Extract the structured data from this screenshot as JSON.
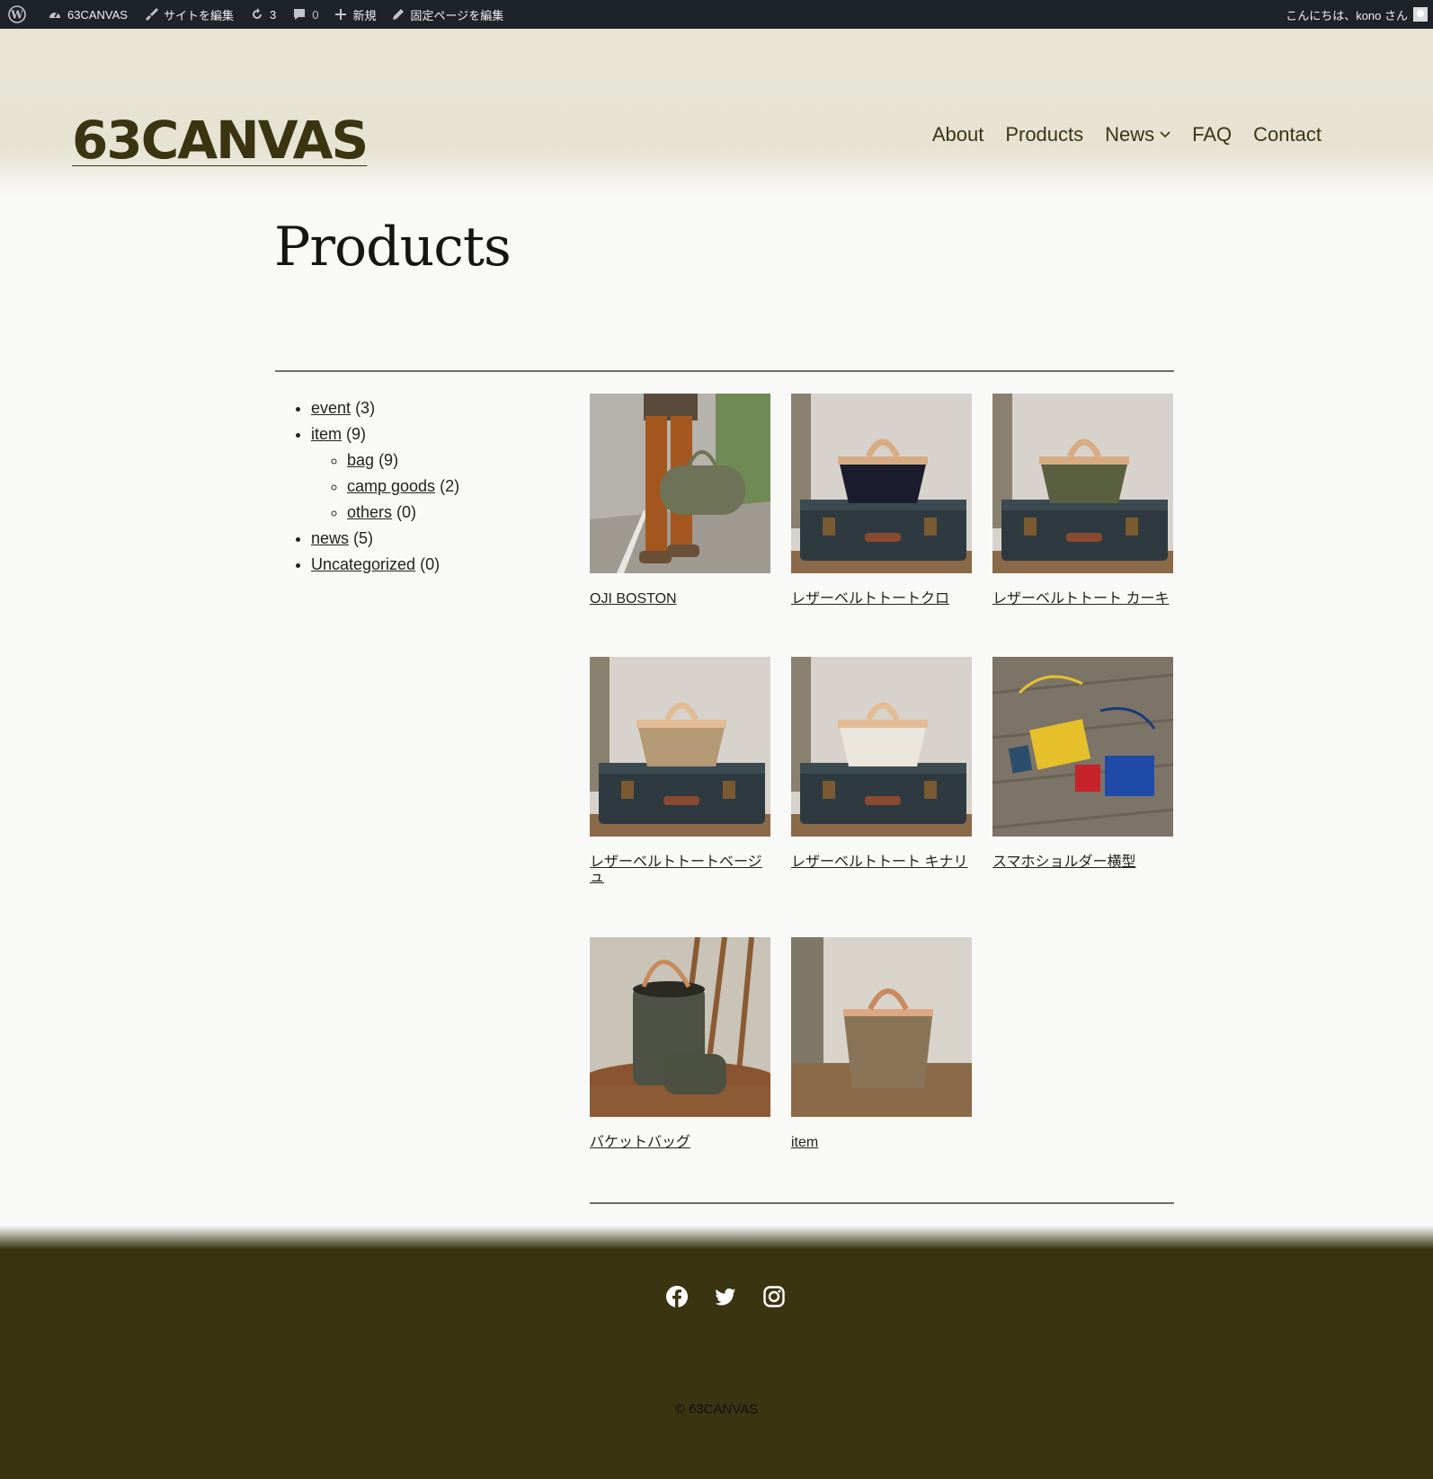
{
  "adminbar": {
    "site_name": "63CANVAS",
    "edit_site": "サイトを編集",
    "updates": "3",
    "comments": "0",
    "new": "新規",
    "edit_page": "固定ページを編集",
    "greeting": "こんにちは、kono さん"
  },
  "header": {
    "site_title": "63CANVAS",
    "nav": [
      "About",
      "Products",
      "News",
      "FAQ",
      "Contact"
    ]
  },
  "page": {
    "title": "Products"
  },
  "categories": [
    {
      "name": "event",
      "count": "(3)"
    },
    {
      "name": "item",
      "count": "(9)",
      "children": [
        {
          "name": "bag",
          "count": "(9)"
        },
        {
          "name": "camp goods",
          "count": "(2)"
        },
        {
          "name": "others",
          "count": "(0)"
        }
      ]
    },
    {
      "name": "news",
      "count": "(5)"
    },
    {
      "name": "Uncategorized",
      "count": "(0)"
    }
  ],
  "products": [
    "OJI BOSTON",
    "レザーベルトトートクロ",
    "レザーベルトトート カーキ",
    "レザーベルトトートベージュ",
    "レザーベルトトート キナリ",
    "スマホショルダー横型",
    "バケットバッグ",
    "item"
  ],
  "footer": {
    "social": [
      "facebook-icon",
      "twitter-icon",
      "instagram-icon"
    ],
    "copyright": "© 63CANVAS"
  },
  "colors": {
    "accent": "#3a3411",
    "header_bg": "#e7e4d4",
    "adminbar_bg": "#1d2327"
  }
}
